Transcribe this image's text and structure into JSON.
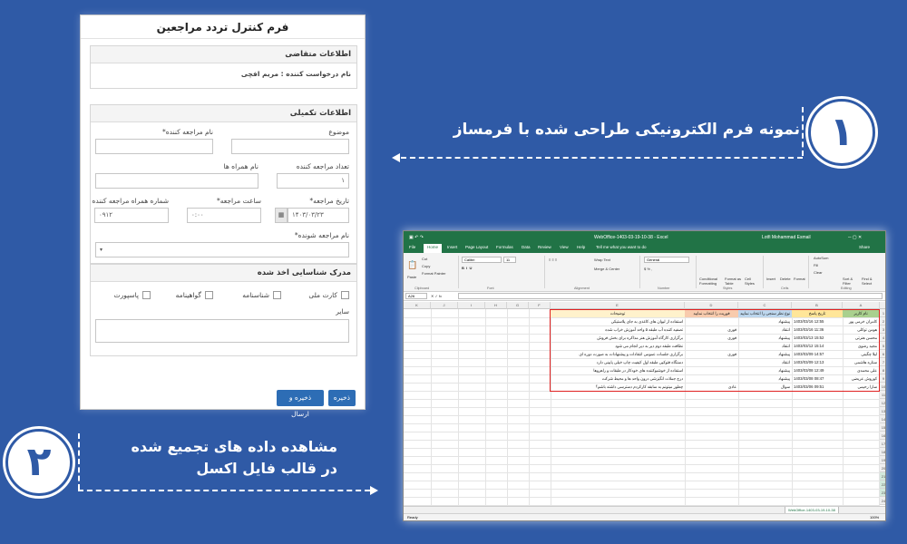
{
  "form": {
    "title": "فرم کنترل تردد مراجعین",
    "applicant_section": {
      "heading": "اطلاعات متقاضی",
      "requester_label": "نام درخواست کننده : مریم افچی"
    },
    "extra_section": {
      "heading": "اطلاعات تکمیلی",
      "subject_label": "موضوع",
      "visitor_name_label": "نام مراجعه کننده*",
      "companion_count_label": "تعداد مراجعه کننده",
      "companion_count_value": "۱",
      "companion_names_label": "نام همراه ها",
      "visit_date_label": "تاریخ مراجعه*",
      "visit_date_value": "۱۴۰۳/۰۳/۲۳",
      "visit_time_label": "ساعت مراجعه*",
      "visit_time_value": "۰:۰۰",
      "companion_phone_label": "شماره همراه مراجعه کننده",
      "companion_phone_value": "۰۹۱۲",
      "host_name_label": "نام مراجعه شونده*",
      "host_select_value": "▾"
    },
    "id_section": {
      "heading": "مدرک شناسایی اخذ شده",
      "options": [
        "کارت ملی",
        "شناسنامه",
        "گواهینامه",
        "پاسپورت"
      ],
      "other_label": "سایر"
    },
    "buttons": {
      "save": "ذخیره",
      "save_send": "ذخیره و ارسال"
    }
  },
  "callout1": {
    "number": "۱",
    "text": "نمونه فرم الکترونیکی طراحی شده با فرمساز"
  },
  "callout2": {
    "number": "۲",
    "line1": "مشاهده داده های تجمیع شده",
    "line2": "در قالب فایل اکسل"
  },
  "excel": {
    "title": "WebOffice-1403-03-19-10-38 - Excel",
    "user": "Lotfi Mohammad Esmail",
    "share": "Share",
    "tabs": [
      "File",
      "Home",
      "Insert",
      "Page Layout",
      "Formulas",
      "Data",
      "Review",
      "View",
      "Help",
      "Tell me what you want to do"
    ],
    "ribbon": {
      "paste": "Paste",
      "cut": "Cut",
      "copy": "Copy",
      "format_painter": "Format Painter",
      "font_name": "Calibri",
      "font_size": "11",
      "wrap_text": "Wrap Text",
      "merge_center": "Merge & Center",
      "number_format": "General",
      "conditional": "Conditional Formatting",
      "format_table": "Format as Table",
      "cell_styles": "Cell Styles",
      "insert": "Insert",
      "delete": "Delete",
      "format": "Format",
      "autosum": "AutoSum",
      "fill": "Fill",
      "clear": "Clear",
      "sort_filter": "Sort & Filter",
      "find_select": "Find & Select",
      "groups": [
        "Clipboard",
        "Font",
        "Alignment",
        "Number",
        "Styles",
        "Cells",
        "Editing"
      ]
    },
    "name_box": "A26",
    "columns": [
      "A",
      "B",
      "C",
      "D",
      "E",
      "F",
      "G",
      "H",
      "I",
      "J",
      "K"
    ],
    "headers": [
      "نام کاربر",
      "تاریخ پاسخ",
      "نوع نظر سنجی را انتخاب نمایید",
      "فوریت را انتخاب نمایید",
      "توضیحات"
    ],
    "rows": [
      [
        "کامران خرمی پور",
        "1403/03/16 12:55",
        "پیشنهاد",
        "",
        "استفاده از لیوان های کاغذی به جای پلاستیکی"
      ],
      [
        "هومن توکلی",
        "1403/03/16 11:36",
        "انتقاد",
        "فوری",
        "تصفیه کننده آب طبقه ۵ واحد آموزش خراب شده"
      ],
      [
        "محسن هنرتی",
        "1403/03/13 15:52",
        "پیشنهاد",
        "فوری",
        "برگزاری کارگاه آموزش هنر مذاکره برای بخش فروش"
      ],
      [
        "مجید رضوی",
        "1403/03/12 15:14",
        "انتقاد",
        "",
        "نظافت طبقه دوم دیر به دیر انجام می شود"
      ],
      [
        "لیلا چگینی",
        "1403/03/09 14:57",
        "پیشنهاد",
        "فوری",
        "برگزاری جلسات عمومی انتقادات و پیشنهادات به صورت دوره ای"
      ],
      [
        "ستاره هاشمی",
        "1403/03/09 12:13",
        "انتقاد",
        "",
        "دستگاه فتوکپی طبقه اول کیفیت چاپ خیلی پایینی دارد"
      ],
      [
        "علی محمدی",
        "1403/03/08 12:49",
        "پیشنهاد",
        "",
        "استفاده از خوشبوکننده های خودکار در طبقات و راهروها"
      ],
      [
        "کوروش عریضی",
        "1403/03/08 08:47",
        "پیشنهاد",
        "",
        "درج جملات انگیزشی درون واحد ها و محیط شرکت"
      ],
      [
        "سارا رحیمی",
        "1403/03/06 09:51",
        "سوال",
        "عادی",
        "چطور میتونم به سابقه کارکردم دسترسی داشته باشم؟"
      ]
    ],
    "sheet_tab": "WebOffice-1403-03-19-10-38",
    "status": "Ready",
    "zoom": "100%"
  }
}
